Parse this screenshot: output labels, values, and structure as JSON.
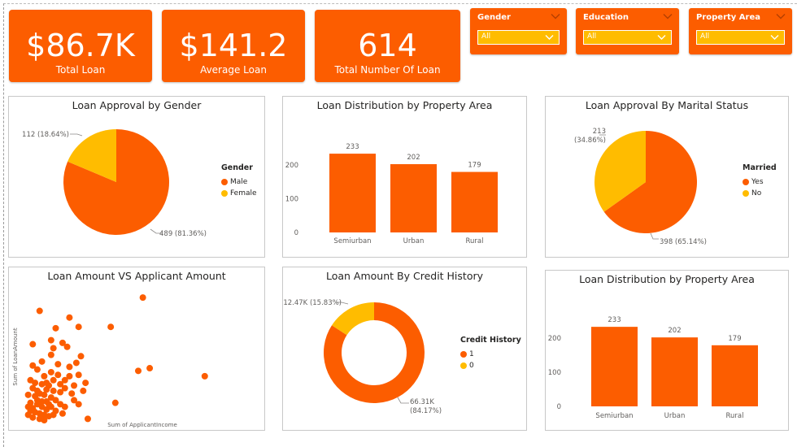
{
  "kpis": [
    {
      "value": "$86.7K",
      "label": "Total Loan"
    },
    {
      "value": "$141.2",
      "label": "Average Loan"
    },
    {
      "value": "614",
      "label": "Total Number Of Loan"
    }
  ],
  "slicers": [
    {
      "title": "Gender",
      "value": "All"
    },
    {
      "title": "Education",
      "value": "All"
    },
    {
      "title": "Property Area",
      "value": "All"
    }
  ],
  "colors": {
    "primary": "#fc5d00",
    "secondary": "#ffbc00"
  },
  "chart_data": [
    {
      "type": "pie",
      "title": "Loan Approval by Gender",
      "legend_title": "Gender",
      "legend_position": "right",
      "slices": [
        {
          "name": "Male",
          "value": 489,
          "label": "489 (81.36%)",
          "color": "#fc5d00"
        },
        {
          "name": "Female",
          "value": 112,
          "label": "112 (18.64%)",
          "color": "#ffbc00"
        }
      ]
    },
    {
      "type": "bar",
      "title": "Loan Distribution by Property Area",
      "categories": [
        "Semiurban",
        "Urban",
        "Rural"
      ],
      "values": [
        233,
        202,
        179
      ],
      "yticks": [
        "0",
        "100",
        "200"
      ],
      "ylim": [
        0,
        250
      ],
      "grid": false,
      "color": "#fc5d00"
    },
    {
      "type": "pie",
      "title": "Loan Approval By Marital Status",
      "legend_title": "Married",
      "legend_position": "right",
      "slices": [
        {
          "name": "Yes",
          "value": 398,
          "label": "398 (65.14%)",
          "color": "#fc5d00"
        },
        {
          "name": "No",
          "value": 213,
          "label_lines": [
            "213",
            "(34.86%)"
          ],
          "color": "#ffbc00"
        }
      ]
    },
    {
      "type": "scatter",
      "title": "Loan Amount VS Applicant Amount",
      "xlabel": "Sum of ApplicantIncome",
      "ylabel": "Sum of LoanAmount",
      "color": "#fc5d00",
      "points": [
        [
          0.52,
          0.92
        ],
        [
          0.2,
          0.77
        ],
        [
          0.07,
          0.82
        ],
        [
          0.24,
          0.7
        ],
        [
          0.12,
          0.49
        ],
        [
          0.14,
          0.69
        ],
        [
          0.38,
          0.7
        ],
        [
          0.04,
          0.57
        ],
        [
          0.23,
          0.43
        ],
        [
          0.5,
          0.37
        ],
        [
          0.55,
          0.39
        ],
        [
          0.79,
          0.33
        ],
        [
          0.4,
          0.13
        ],
        [
          0.12,
          0.6
        ],
        [
          0.17,
          0.58
        ],
        [
          0.13,
          0.54
        ],
        [
          0.19,
          0.55
        ],
        [
          0.2,
          0.4
        ],
        [
          0.24,
          0.34
        ],
        [
          0.26,
          0.22
        ],
        [
          0.1,
          0.14
        ],
        [
          0.22,
          0.26
        ],
        [
          0.27,
          0.28
        ],
        [
          0.06,
          0.38
        ],
        [
          0.09,
          0.33
        ],
        [
          0.15,
          0.34
        ],
        [
          0.18,
          0.3
        ],
        [
          0.03,
          0.3
        ],
        [
          0.04,
          0.24
        ],
        [
          0.08,
          0.27
        ],
        [
          0.11,
          0.26
        ],
        [
          0.05,
          0.18
        ],
        [
          0.07,
          0.2
        ],
        [
          0.09,
          0.19
        ],
        [
          0.12,
          0.17
        ],
        [
          0.03,
          0.13
        ],
        [
          0.06,
          0.12
        ],
        [
          0.08,
          0.1
        ],
        [
          0.1,
          0.08
        ],
        [
          0.12,
          0.1
        ],
        [
          0.03,
          0.07
        ],
        [
          0.05,
          0.06
        ],
        [
          0.07,
          0.05
        ],
        [
          0.09,
          0.04
        ],
        [
          0.11,
          0.03
        ],
        [
          0.14,
          0.07
        ],
        [
          0.16,
          0.12
        ],
        [
          0.16,
          0.21
        ],
        [
          0.13,
          0.22
        ],
        [
          0.1,
          0.23
        ],
        [
          0.04,
          0.09
        ],
        [
          0.06,
          0.15
        ],
        [
          0.08,
          0.14
        ],
        [
          0.11,
          0.12
        ],
        [
          0.02,
          0.04
        ],
        [
          0.04,
          0.02
        ],
        [
          0.07,
          0.01
        ],
        [
          0.09,
          0.0
        ],
        [
          0.21,
          0.2
        ],
        [
          0.18,
          0.24
        ],
        [
          0.02,
          0.19
        ],
        [
          0.05,
          0.28
        ],
        [
          0.13,
          0.3
        ],
        [
          0.16,
          0.27
        ],
        [
          0.2,
          0.33
        ],
        [
          0.22,
          0.15
        ],
        [
          0.24,
          0.12
        ],
        [
          0.18,
          0.1
        ],
        [
          0.14,
          0.15
        ],
        [
          0.06,
          0.22
        ],
        [
          0.1,
          0.28
        ],
        [
          0.12,
          0.36
        ],
        [
          0.04,
          0.41
        ],
        [
          0.08,
          0.44
        ],
        [
          0.15,
          0.42
        ],
        [
          0.25,
          0.48
        ],
        [
          0.28,
          0.01
        ],
        [
          0.02,
          0.1
        ],
        [
          0.13,
          0.04
        ],
        [
          0.17,
          0.05
        ]
      ]
    },
    {
      "type": "donut",
      "title": "Loan Amount By Credit History",
      "legend_title": "Credit History",
      "legend_position": "right",
      "slices": [
        {
          "name": "1",
          "value": 66.31,
          "label_lines": [
            "66.31K",
            "(84.17%)"
          ],
          "color": "#fc5d00"
        },
        {
          "name": "0",
          "value": 12.47,
          "label": "12.47K (15.83%)",
          "color": "#ffbc00"
        }
      ]
    },
    {
      "type": "bar",
      "title": "Loan Distribution by Property Area",
      "categories": [
        "Semiurban",
        "Urban",
        "Rural"
      ],
      "values": [
        233,
        202,
        179
      ],
      "yticks": [
        "0",
        "100",
        "200"
      ],
      "ylim": [
        0,
        250
      ],
      "grid": false,
      "color": "#fc5d00"
    }
  ]
}
